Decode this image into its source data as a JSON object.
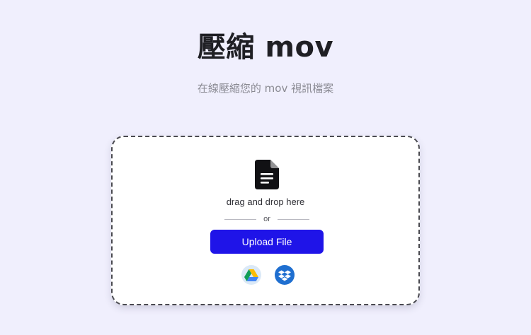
{
  "header": {
    "title": "壓縮 mov",
    "subtitle": "在線壓縮您的 mov 視訊檔案"
  },
  "dropzone": {
    "drag_text": "drag and drop here",
    "or_text": "or",
    "upload_label": "Upload File"
  },
  "icons": {
    "file": "file-document-icon",
    "google_drive": "google-drive-icon",
    "dropbox": "dropbox-icon"
  },
  "colors": {
    "background": "#f0effd",
    "primary_button": "#1f14e8",
    "dropbox_blue": "#1f6fd0"
  }
}
